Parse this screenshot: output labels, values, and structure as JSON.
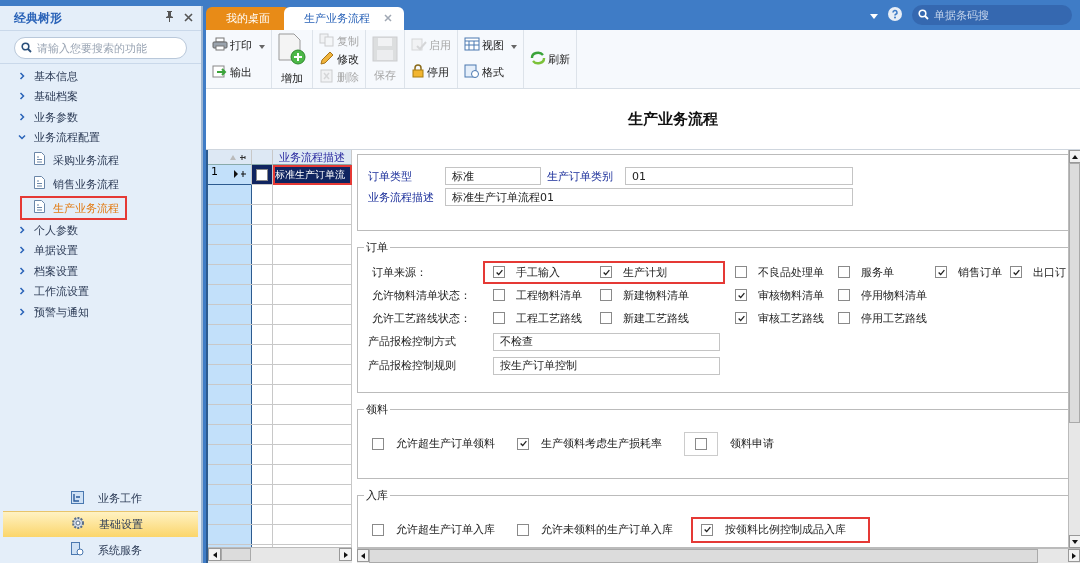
{
  "sidebar": {
    "title": "经典树形",
    "search": {
      "placeholder": "请输入您要搜索的功能"
    },
    "tree": [
      {
        "label": "基本信息",
        "expanded": false
      },
      {
        "label": "基础档案",
        "expanded": false
      },
      {
        "label": "业务参数",
        "expanded": false
      },
      {
        "label": "业务流程配置",
        "expanded": true,
        "children": [
          {
            "label": "采购业务流程",
            "selected": false,
            "highlighted": false
          },
          {
            "label": "销售业务流程",
            "selected": false,
            "highlighted": false
          },
          {
            "label": "生产业务流程",
            "selected": true,
            "highlighted": true
          }
        ]
      },
      {
        "label": "个人参数",
        "expanded": false
      },
      {
        "label": "单据设置",
        "expanded": false
      },
      {
        "label": "档案设置",
        "expanded": false
      },
      {
        "label": "工作流设置",
        "expanded": false
      },
      {
        "label": "预警与通知",
        "expanded": false
      }
    ],
    "modules": [
      {
        "label": "业务工作",
        "selected": false
      },
      {
        "label": "基础设置",
        "selected": true
      },
      {
        "label": "系统服务",
        "selected": false
      }
    ]
  },
  "tabs": [
    {
      "label": "我的桌面",
      "selected": false,
      "closable": false
    },
    {
      "label": "生产业务流程",
      "selected": true,
      "closable": true
    }
  ],
  "global_search": {
    "placeholder": "单据条码搜"
  },
  "toolbar": [
    [
      {
        "label": "打印",
        "kind": "small",
        "disabled": false,
        "dropdown": true
      },
      {
        "label": "输出",
        "kind": "small",
        "disabled": false,
        "dropdown": false
      }
    ],
    [
      {
        "label": "增加",
        "kind": "large",
        "disabled": false,
        "dropdown": false
      }
    ],
    [
      {
        "label": "复制",
        "kind": "small",
        "disabled": true,
        "dropdown": false
      },
      {
        "label": "修改",
        "kind": "small",
        "disabled": false,
        "dropdown": false
      },
      {
        "label": "删除",
        "kind": "small",
        "disabled": true,
        "dropdown": false
      }
    ],
    [
      {
        "label": "保存",
        "kind": "large",
        "disabled": true,
        "dropdown": false
      }
    ],
    [
      {
        "label": "启用",
        "kind": "small",
        "disabled": true,
        "dropdown": false
      },
      {
        "label": "停用",
        "kind": "small",
        "disabled": false,
        "dropdown": false
      }
    ],
    [
      {
        "label": "视图",
        "kind": "small",
        "disabled": false,
        "dropdown": true
      },
      {
        "label": "格式",
        "kind": "small",
        "disabled": false,
        "dropdown": false
      }
    ],
    [
      {
        "label": "刷新",
        "kind": "small",
        "disabled": false,
        "dropdown": false
      }
    ]
  ],
  "page_title": "生产业务流程",
  "grid": {
    "columns": [
      "业务流程描述"
    ],
    "rows": [
      {
        "number": "1",
        "value": "标准生产订单流",
        "selected": true,
        "checked": false,
        "highlighted": true
      }
    ]
  },
  "form": {
    "header_fields": [
      [
        {
          "label": "订单类型",
          "value": "标准"
        },
        {
          "label": "生产订单类别",
          "value": "01"
        }
      ],
      [
        {
          "label": "业务流程描述",
          "value": "标准生产订单流程01"
        }
      ]
    ],
    "sections": [
      {
        "title": "订单",
        "rows": [
          {
            "kind": "options",
            "label": "订单来源：",
            "options": [
              {
                "label": "手工输入",
                "checked": true,
                "highlighted": true
              },
              {
                "label": "生产计划",
                "checked": true,
                "highlighted": true
              },
              {
                "label": "不良品处理单",
                "checked": false,
                "highlighted": false
              },
              {
                "label": "服务单",
                "checked": false,
                "highlighted": false
              },
              {
                "label": "销售订单",
                "checked": true,
                "highlighted": false
              },
              {
                "label": "出口订",
                "checked": true,
                "highlighted": false
              }
            ]
          },
          {
            "kind": "options",
            "label": "允许物料清单状态：",
            "options": [
              {
                "label": "工程物料清单",
                "checked": false,
                "highlighted": false
              },
              {
                "label": "新建物料清单",
                "checked": false,
                "highlighted": false
              },
              {
                "label": "审核物料清单",
                "checked": true,
                "highlighted": false
              },
              {
                "label": "停用物料清单",
                "checked": false,
                "highlighted": false
              }
            ]
          },
          {
            "kind": "options",
            "label": "允许工艺路线状态：",
            "options": [
              {
                "label": "工程工艺路线",
                "checked": false,
                "highlighted": false
              },
              {
                "label": "新建工艺路线",
                "checked": false,
                "highlighted": false
              },
              {
                "label": "审核工艺路线",
                "checked": true,
                "highlighted": false
              },
              {
                "label": "停用工艺路线",
                "checked": false,
                "highlighted": false
              }
            ]
          },
          {
            "kind": "field",
            "label": "产品报检控制方式",
            "value": "不检查"
          },
          {
            "kind": "field",
            "label": "产品报检控制规则",
            "value": "按生产订单控制"
          }
        ]
      },
      {
        "title": "领料",
        "rows": [
          {
            "kind": "inline",
            "options": [
              {
                "label": "允许超生产订单领料",
                "checked": false,
                "highlighted": false,
                "boxed": false
              },
              {
                "label": "生产领料考虑生产损耗率",
                "checked": true,
                "highlighted": false,
                "boxed": false
              },
              {
                "label": "领料申请",
                "checked": false,
                "highlighted": false,
                "boxed": true
              }
            ]
          }
        ]
      },
      {
        "title": "入库",
        "rows": [
          {
            "kind": "inline",
            "options": [
              {
                "label": "允许超生产订单入库",
                "checked": false,
                "highlighted": false,
                "boxed": false
              },
              {
                "label": "允许未领料的生产订单入库",
                "checked": false,
                "highlighted": false,
                "boxed": false
              },
              {
                "label": "按领料比例控制成品入库",
                "checked": true,
                "highlighted": true,
                "boxed": false
              }
            ]
          }
        ]
      }
    ]
  }
}
